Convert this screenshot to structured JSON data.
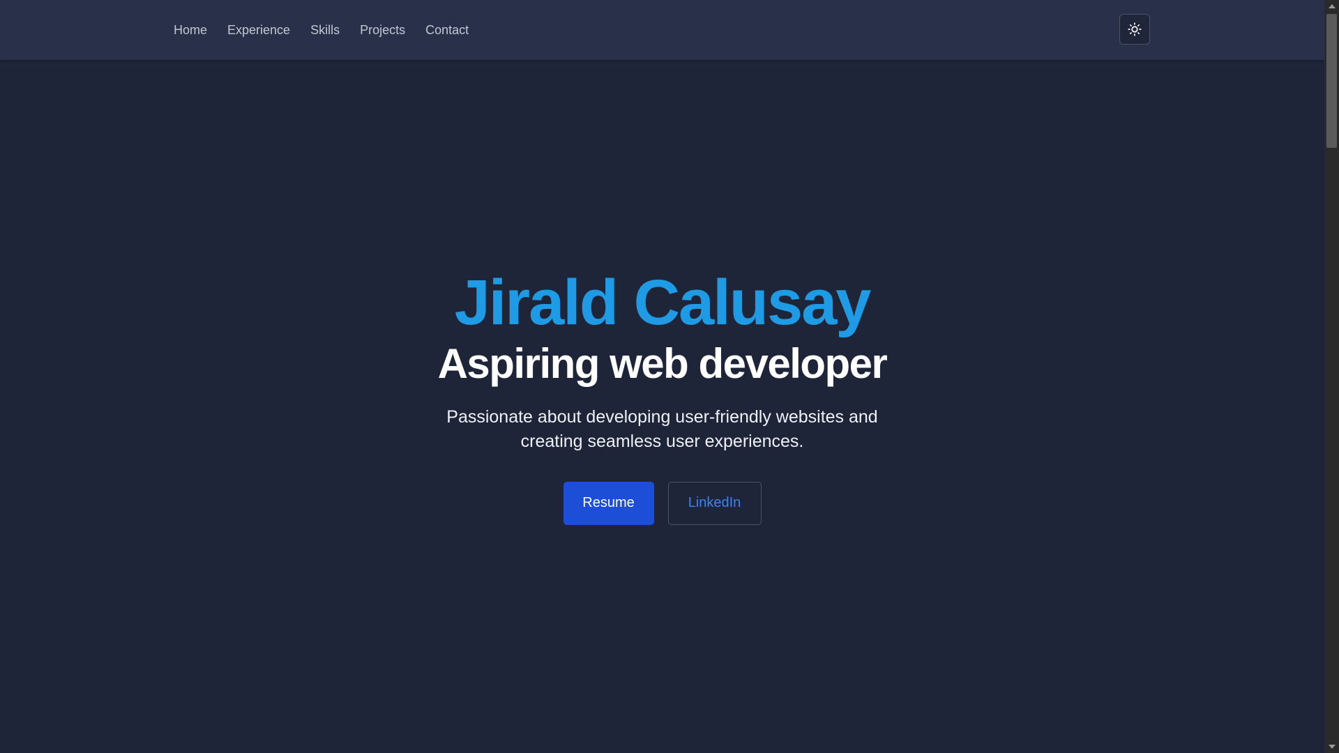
{
  "nav": {
    "items": [
      {
        "label": "Home"
      },
      {
        "label": "Experience"
      },
      {
        "label": "Skills"
      },
      {
        "label": "Projects"
      },
      {
        "label": "Contact"
      }
    ],
    "theme_toggle_icon": "sun-icon"
  },
  "hero": {
    "name": "Jirald Calusay",
    "title": "Aspiring web developer",
    "description": "Passionate about developing user-friendly websites and creating seamless user experiences.",
    "buttons": {
      "resume_label": "Resume",
      "linkedin_label": "LinkedIn"
    }
  },
  "colors": {
    "background": "#1e2538",
    "navbar": "#283149",
    "name_accent": "#1e9be4",
    "primary_button": "#1d4ed8",
    "link_blue": "#3b82f6"
  }
}
